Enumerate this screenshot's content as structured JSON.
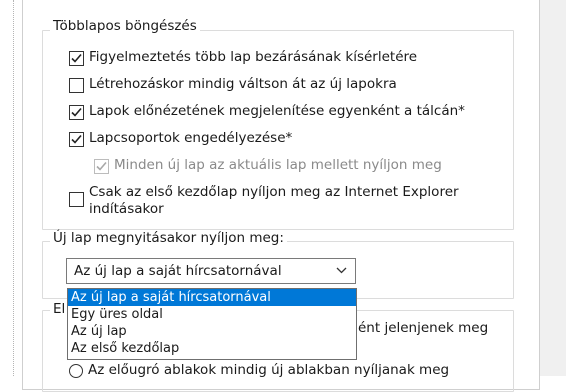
{
  "tabs_group": {
    "legend": "Többlapos böngészés",
    "options": [
      {
        "label": "Figyelmeztetés több lap bezárásának kísérletére",
        "checked": true,
        "disabled": false
      },
      {
        "label": "Létrehozáskor mindig váltson át az új lapokra",
        "checked": false,
        "disabled": false
      },
      {
        "label": "Lapok előnézetének megjelenítése egyenként a tálcán*",
        "checked": true,
        "disabled": false
      },
      {
        "label": "Lapcsoportok engedélyezése*",
        "checked": true,
        "disabled": false
      },
      {
        "label": "Minden új lap az aktuális lap mellett nyíljon meg",
        "checked": true,
        "disabled": true
      },
      {
        "label_line1": "Csak az első kezdőlap nyíljon meg az Internet Explorer",
        "label_line2": "indításakor",
        "checked": false,
        "disabled": false
      }
    ]
  },
  "new_tab_group": {
    "legend": "Új lap megnyitásakor nyíljon meg:",
    "selected": "Az új lap a saját hírcsatornával",
    "options": [
      "Az új lap a saját hírcsatornával",
      "Egy üres oldal",
      "Az új lap",
      "Az első kezdőlap"
    ]
  },
  "popup_group": {
    "legend_partial": "El",
    "hidden_row_tail": "ént jelenjenek meg",
    "radio_partial": "Az előugró ablakok mindig új ablakban nyíljanak meg"
  }
}
